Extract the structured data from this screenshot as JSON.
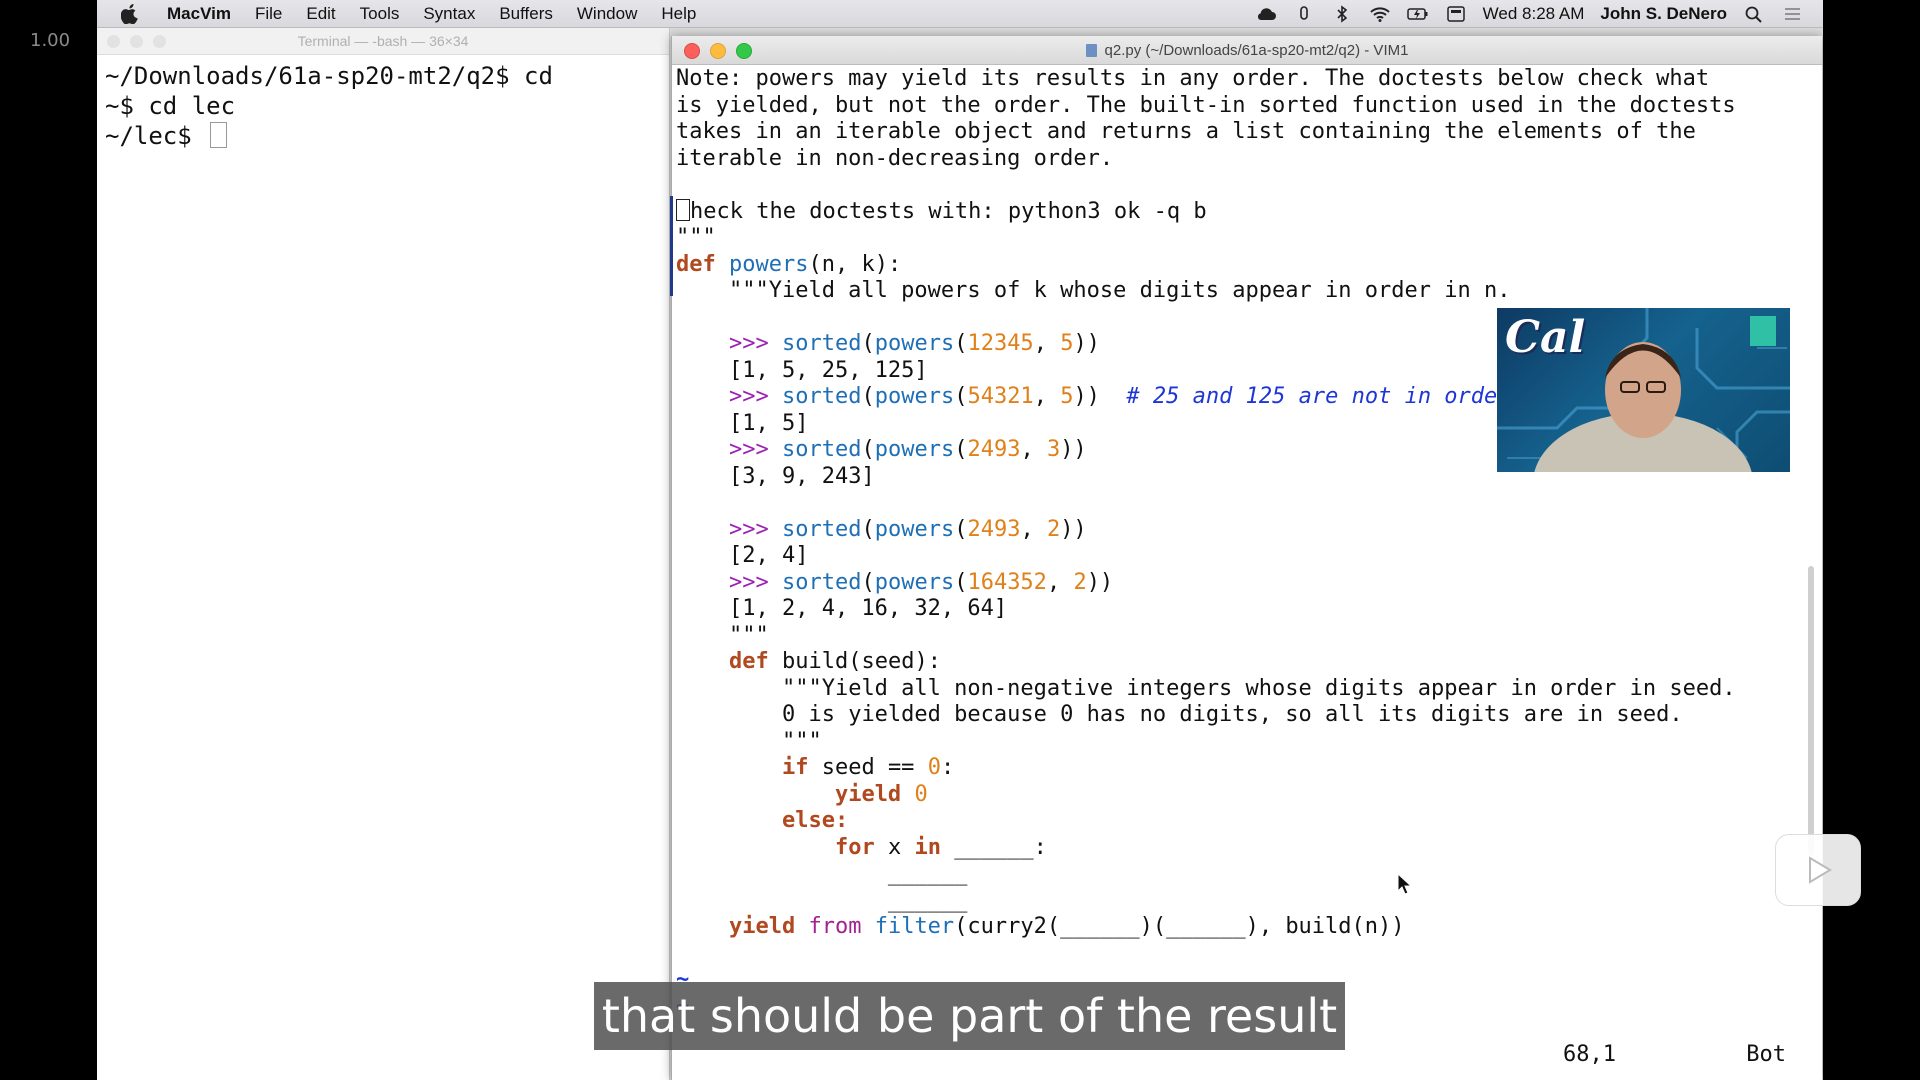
{
  "player": {
    "speed": "1.00",
    "subtitle": "that should be part of the result"
  },
  "menubar": {
    "app_name": "MacVim",
    "items": [
      "File",
      "Edit",
      "Tools",
      "Syntax",
      "Buffers",
      "Window",
      "Help"
    ],
    "clock": "Wed 8:28 AM",
    "user": "John S. DeNero",
    "icons": [
      "cloud-icon",
      "mic-icon",
      "bluetooth-icon",
      "wifi-icon",
      "battery-icon",
      "keyboard-icon",
      "search-icon",
      "list-icon"
    ]
  },
  "terminal": {
    "title": "Terminal — -bash — 36×34",
    "lines": [
      "~/Downloads/61a-sp20-mt2/q2$ cd",
      "~$ cd lec",
      "~/lec$ "
    ]
  },
  "vim": {
    "title": "q2.py (~/Downloads/61a-sp20-mt2/q2) - VIM1",
    "status_position": "68,1",
    "status_scroll": "Bot",
    "lines": {
      "l1": "Note: powers may yield its results in any order. The doctests below check what",
      "l2": "is yielded, but not the order. The built-in sorted function used in the doctests",
      "l3": "takes in an iterable object and returns a list containing the elements of the",
      "l4": "iterable in non-decreasing order.",
      "l6": "heck the doctests with: python3 ok -q b",
      "l7": "\"\"\"",
      "l8_kw": "def",
      "l8_fn": "powers",
      "l8_rest": "(n, k):",
      "l9": "    \"\"\"Yield all powers of k whose digits appear in order in n.",
      "l11": "[1, 5, 25, 125]",
      "l12_cmt": "# 25 and 125 are not in order",
      "l13": "[1, 5]",
      "l15": "[3, 9, 243]",
      "l18": "[2, 4]",
      "l20": "[1, 2, 4, 16, 32, 64]",
      "l21": "\"\"\"",
      "l22_kw": "def",
      "l22_fn": "build",
      "l22_rest": "(seed):",
      "l23": "\"\"\"Yield all non-negative integers whose digits appear in order in seed.",
      "l24": "0 is yielded because 0 has no digits, so all its digits are in seed.",
      "l25": "\"\"\"",
      "l26_kw": "if",
      "l26_rest": " seed == ",
      "l26_num": "0",
      "l27_kw": "yield",
      "l27_num": "0",
      "l28_kw": "else:",
      "l29_kw": "for",
      "l29_a": " x ",
      "l29_kw2": "in",
      "l29_b": " ______:",
      "l30": "______",
      "l31": "______",
      "l32_kw": "yield",
      "l32_kw2": "from",
      "l32_fn": "filter",
      "l32_rest": "(curry2(______)(______), build(n))",
      "tilde": "~"
    },
    "doctests": [
      {
        "call": "powers",
        "a": "12345",
        "b": "5"
      },
      {
        "call": "powers",
        "a": "54321",
        "b": "5"
      },
      {
        "call": "powers",
        "a": "2493",
        "b": "3"
      },
      {
        "call": "powers",
        "a": "2493",
        "b": "2"
      },
      {
        "call": "powers",
        "a": "164352",
        "b": "2"
      }
    ],
    "prompt": ">>>",
    "sorted": "sorted"
  },
  "webcam": {
    "logo_text": "Cal"
  },
  "colors": {
    "keyword": "#b0491f",
    "function": "#1f6fb6",
    "number": "#e0801a",
    "prompt": "#9b1fb5",
    "comment": "#1e36d6"
  }
}
